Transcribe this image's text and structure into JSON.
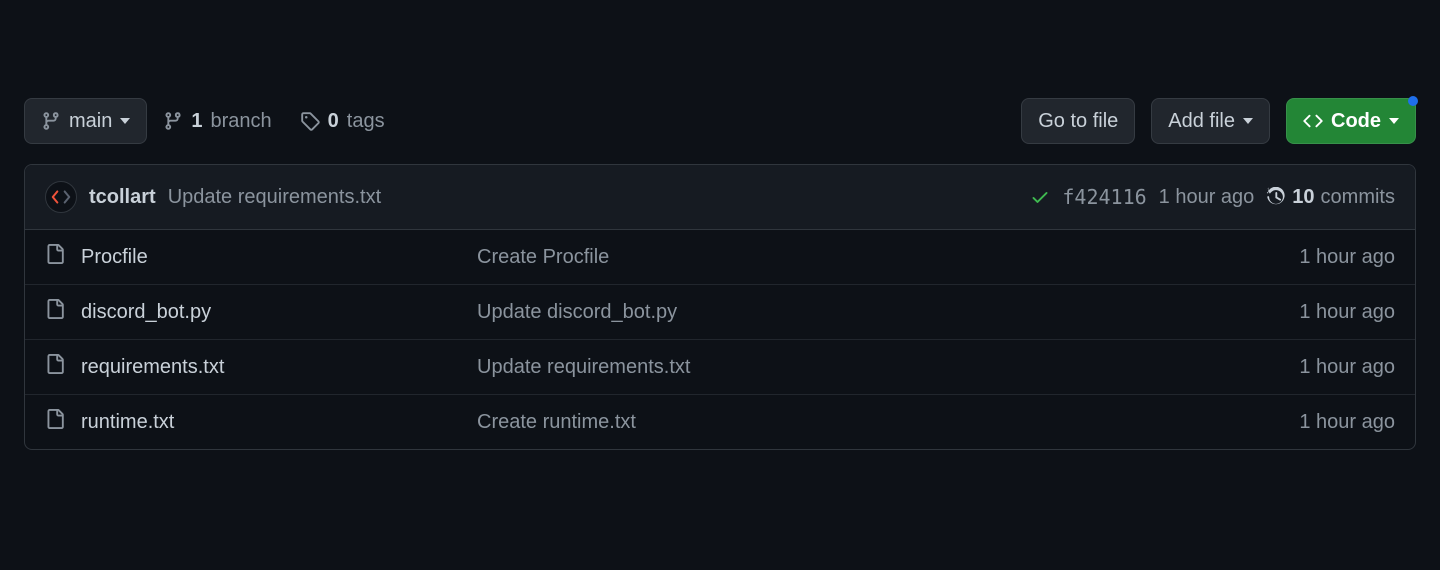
{
  "toolbar": {
    "branch_name": "main",
    "branch_count": "1",
    "branch_label": "branch",
    "tag_count": "0",
    "tag_label": "tags",
    "go_to_file": "Go to file",
    "add_file": "Add file",
    "code": "Code"
  },
  "latest_commit": {
    "author": "tcollart",
    "message": "Update requirements.txt",
    "sha": "f424116",
    "time": "1 hour ago",
    "commits_count": "10",
    "commits_label": "commits"
  },
  "files": [
    {
      "name": "Procfile",
      "message": "Create Procfile",
      "time": "1 hour ago"
    },
    {
      "name": "discord_bot.py",
      "message": "Update discord_bot.py",
      "time": "1 hour ago"
    },
    {
      "name": "requirements.txt",
      "message": "Update requirements.txt",
      "time": "1 hour ago"
    },
    {
      "name": "runtime.txt",
      "message": "Create runtime.txt",
      "time": "1 hour ago"
    }
  ]
}
